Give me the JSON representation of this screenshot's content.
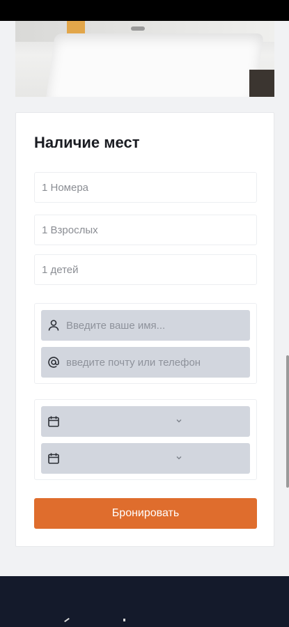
{
  "availability": {
    "title": "Наличие мест",
    "rooms_value": "1 Номера",
    "adults_value": "1 Взрослых",
    "children_value": "1 детей"
  },
  "contact": {
    "name_placeholder": "Введите ваше имя...",
    "email_placeholder": "введите почту или телефон"
  },
  "dates": {
    "checkin_value": "",
    "checkout_value": ""
  },
  "actions": {
    "submit_label": "Бронировать"
  },
  "icons": {
    "name": "user-icon",
    "email": "at-icon",
    "date": "calendar-icon",
    "dropdown": "chevron-down-icon"
  },
  "colors": {
    "accent": "#df6d2d",
    "footer_bg": "#141a2b",
    "input_bg": "#d2d6de"
  }
}
